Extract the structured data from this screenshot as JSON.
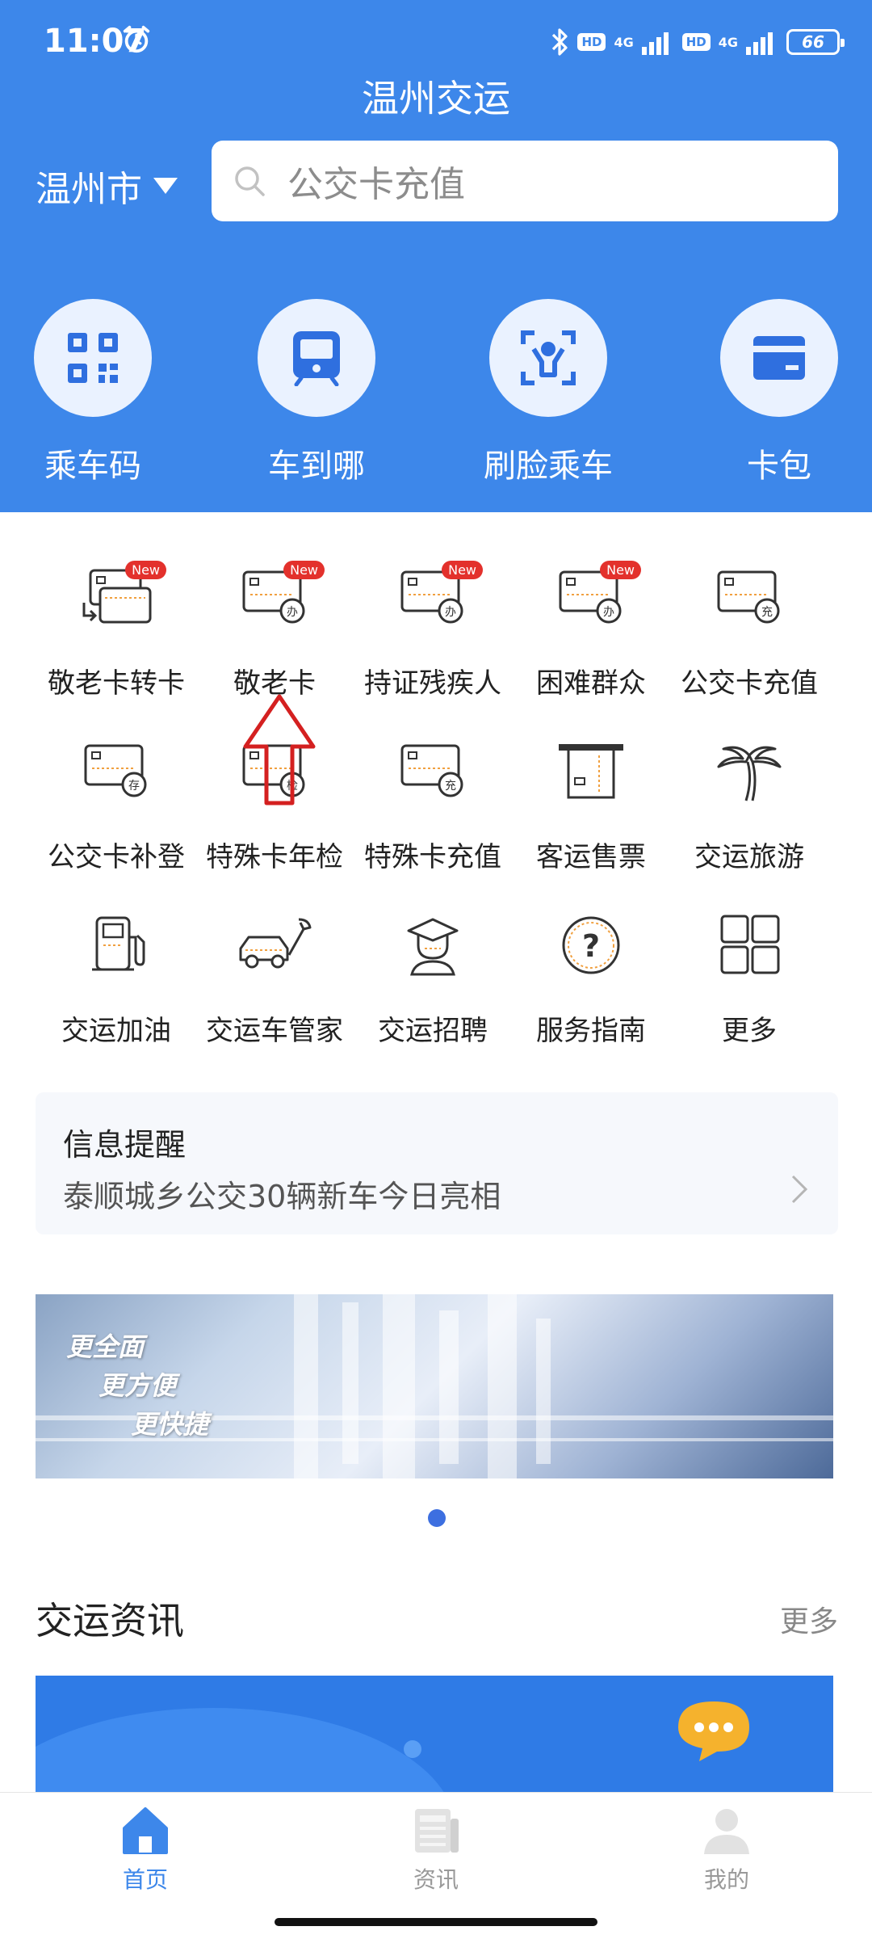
{
  "status_bar": {
    "time": "11:07",
    "hd1": "HD",
    "net1": "4G",
    "hd2": "HD",
    "net2": "4G",
    "battery": "66"
  },
  "app_title": "温州交运",
  "city": "温州市",
  "search": {
    "placeholder": "公交卡充值"
  },
  "quick_actions": [
    {
      "label": "乘车码",
      "icon": "qr-code-icon"
    },
    {
      "label": "车到哪",
      "icon": "bus-icon"
    },
    {
      "label": "刷脸乘车",
      "icon": "face-scan-icon"
    },
    {
      "label": "卡包",
      "icon": "card-wallet-icon"
    }
  ],
  "services": [
    {
      "label": "敬老卡转卡",
      "badge": "New"
    },
    {
      "label": "敬老卡",
      "badge": "New"
    },
    {
      "label": "持证残疾人",
      "badge": "New"
    },
    {
      "label": "困难群众",
      "badge": "New"
    },
    {
      "label": "公交卡充值",
      "tag": "充"
    },
    {
      "label": "公交卡补登",
      "tag": "存"
    },
    {
      "label": "特殊卡年检",
      "tag": "检"
    },
    {
      "label": "特殊卡充值",
      "tag": "充"
    },
    {
      "label": "客运售票"
    },
    {
      "label": "交运旅游"
    },
    {
      "label": "交运加油"
    },
    {
      "label": "交运车管家"
    },
    {
      "label": "交运招聘"
    },
    {
      "label": "服务指南"
    },
    {
      "label": "更多"
    }
  ],
  "info": {
    "title": "信息提醒",
    "text": "泰顺城乡公交30辆新车今日亮相"
  },
  "banner": {
    "line1": "更全面",
    "line2": "更方便",
    "line3": "更快捷"
  },
  "news": {
    "title": "交运资讯",
    "more": "更多"
  },
  "bottom_nav": [
    {
      "label": "首页",
      "active": true
    },
    {
      "label": "资讯",
      "active": false
    },
    {
      "label": "我的",
      "active": false
    }
  ],
  "colors": {
    "brand": "#3d87ea",
    "badge": "#e3312c",
    "arrow": "#d42020"
  }
}
